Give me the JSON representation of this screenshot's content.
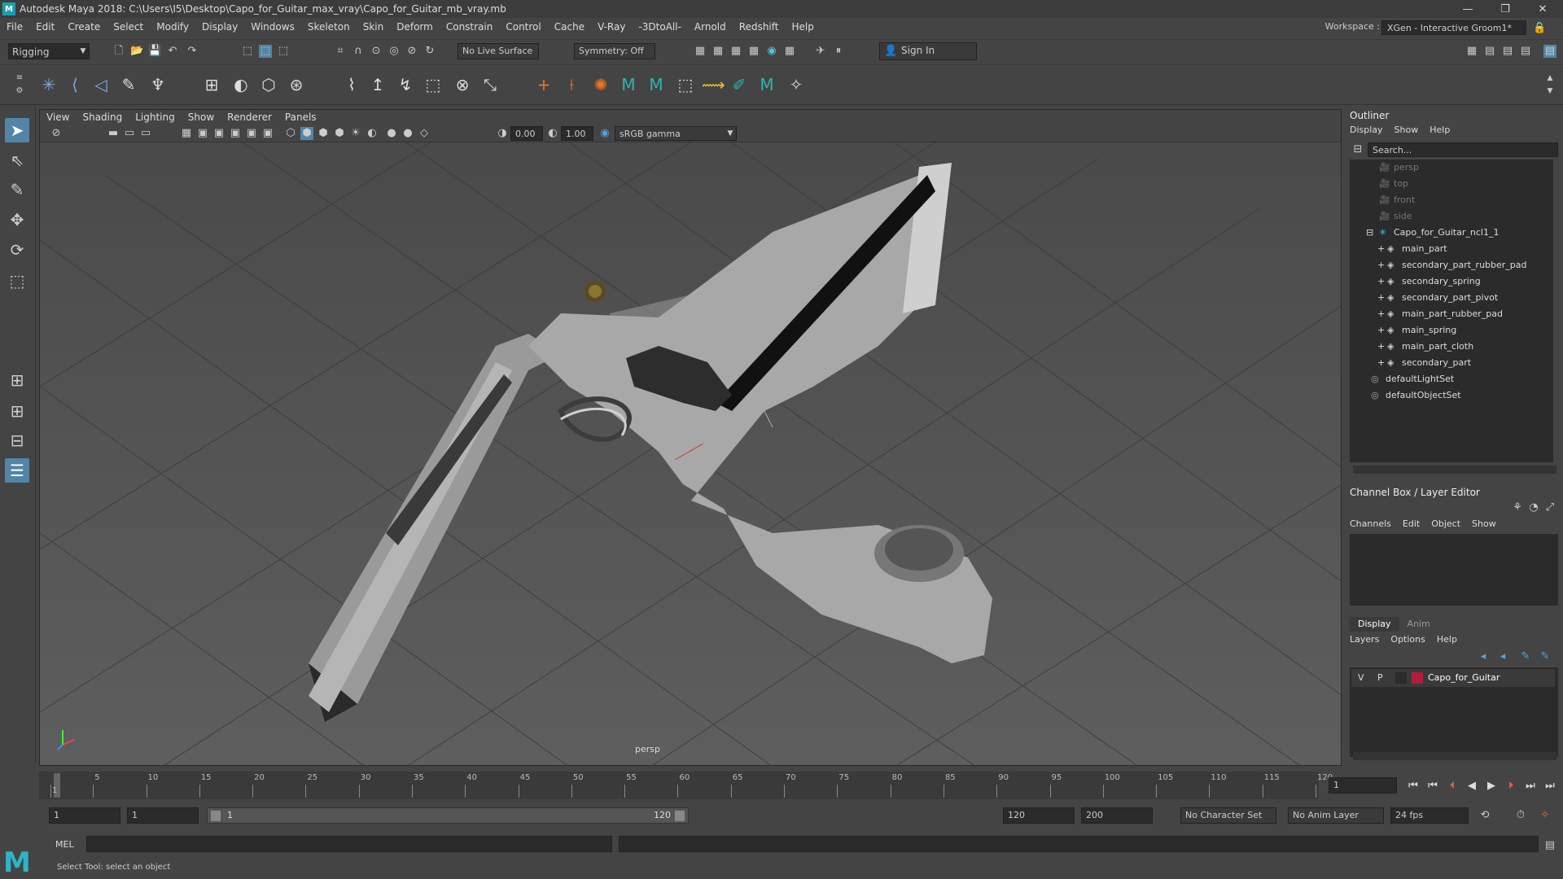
{
  "window": {
    "title": "Autodesk Maya 2018: C:\\Users\\I5\\Desktop\\Capo_for_Guitar_max_vray\\Capo_for_Guitar_mb_vray.mb",
    "app_icon": "M"
  },
  "menus": [
    "File",
    "Edit",
    "Create",
    "Select",
    "Modify",
    "Display",
    "Windows",
    "Skeleton",
    "Skin",
    "Deform",
    "Constrain",
    "Control",
    "Cache",
    "V-Ray",
    "-3DtoAll-",
    "Arnold",
    "Redshift",
    "Help"
  ],
  "workspace": {
    "label": "Workspace :",
    "value": "XGen - Interactive Groom1*"
  },
  "status": {
    "mode": "Rigging",
    "live_surface": "No Live Surface",
    "symmetry": "Symmetry: Off",
    "sign_in": "Sign In"
  },
  "viewport": {
    "menus": [
      "View",
      "Shading",
      "Lighting",
      "Show",
      "Renderer",
      "Panels"
    ],
    "exposure": "0.00",
    "gamma": "1.00",
    "color_space": "sRGB gamma",
    "camera_label": "persp"
  },
  "outliner": {
    "title": "Outliner",
    "menus": [
      "Display",
      "Show",
      "Help"
    ],
    "search_placeholder": "Search...",
    "items": [
      {
        "label": "persp",
        "kind": "camera",
        "dim": true
      },
      {
        "label": "top",
        "kind": "camera",
        "dim": true
      },
      {
        "label": "front",
        "kind": "camera",
        "dim": true
      },
      {
        "label": "side",
        "kind": "camera",
        "dim": true
      },
      {
        "label": "Capo_for_Guitar_ncl1_1",
        "kind": "group",
        "dim": false
      },
      {
        "label": "main_part",
        "kind": "mesh",
        "dim": false
      },
      {
        "label": "secondary_part_rubber_pad",
        "kind": "mesh",
        "dim": false
      },
      {
        "label": "secondary_spring",
        "kind": "mesh",
        "dim": false
      },
      {
        "label": "secondary_part_pivot",
        "kind": "mesh",
        "dim": false
      },
      {
        "label": "main_part_rubber_pad",
        "kind": "mesh",
        "dim": false
      },
      {
        "label": "main_spring",
        "kind": "mesh",
        "dim": false
      },
      {
        "label": "main_part_cloth",
        "kind": "mesh",
        "dim": false
      },
      {
        "label": "secondary_part",
        "kind": "mesh",
        "dim": false
      },
      {
        "label": "defaultLightSet",
        "kind": "set",
        "dim": false
      },
      {
        "label": "defaultObjectSet",
        "kind": "set",
        "dim": false
      }
    ]
  },
  "channelbox": {
    "title": "Channel Box / Layer Editor",
    "menus": [
      "Channels",
      "Edit",
      "Object",
      "Show"
    ]
  },
  "layers": {
    "tabs": [
      "Display",
      "Anim"
    ],
    "menus": [
      "Layers",
      "Options",
      "Help"
    ],
    "layer": {
      "v": "V",
      "p": "P",
      "name": "Capo_for_Guitar",
      "color": "#b01e3c"
    }
  },
  "timeline": {
    "ticks": [
      "1",
      "5",
      "10",
      "15",
      "20",
      "25",
      "30",
      "35",
      "40",
      "45",
      "50",
      "55",
      "60",
      "65",
      "70",
      "75",
      "80",
      "85",
      "90",
      "95",
      "100",
      "105",
      "110",
      "115",
      "120"
    ],
    "current": "1"
  },
  "range": {
    "start": "1",
    "anim_start": "1",
    "slider_start": "1",
    "slider_end": "120",
    "end": "120",
    "anim_end": "200",
    "character_set": "No Character Set",
    "anim_layer": "No Anim Layer",
    "fps": "24 fps"
  },
  "cmd": {
    "label": "MEL"
  },
  "help": {
    "text": "Select Tool: select an object"
  }
}
